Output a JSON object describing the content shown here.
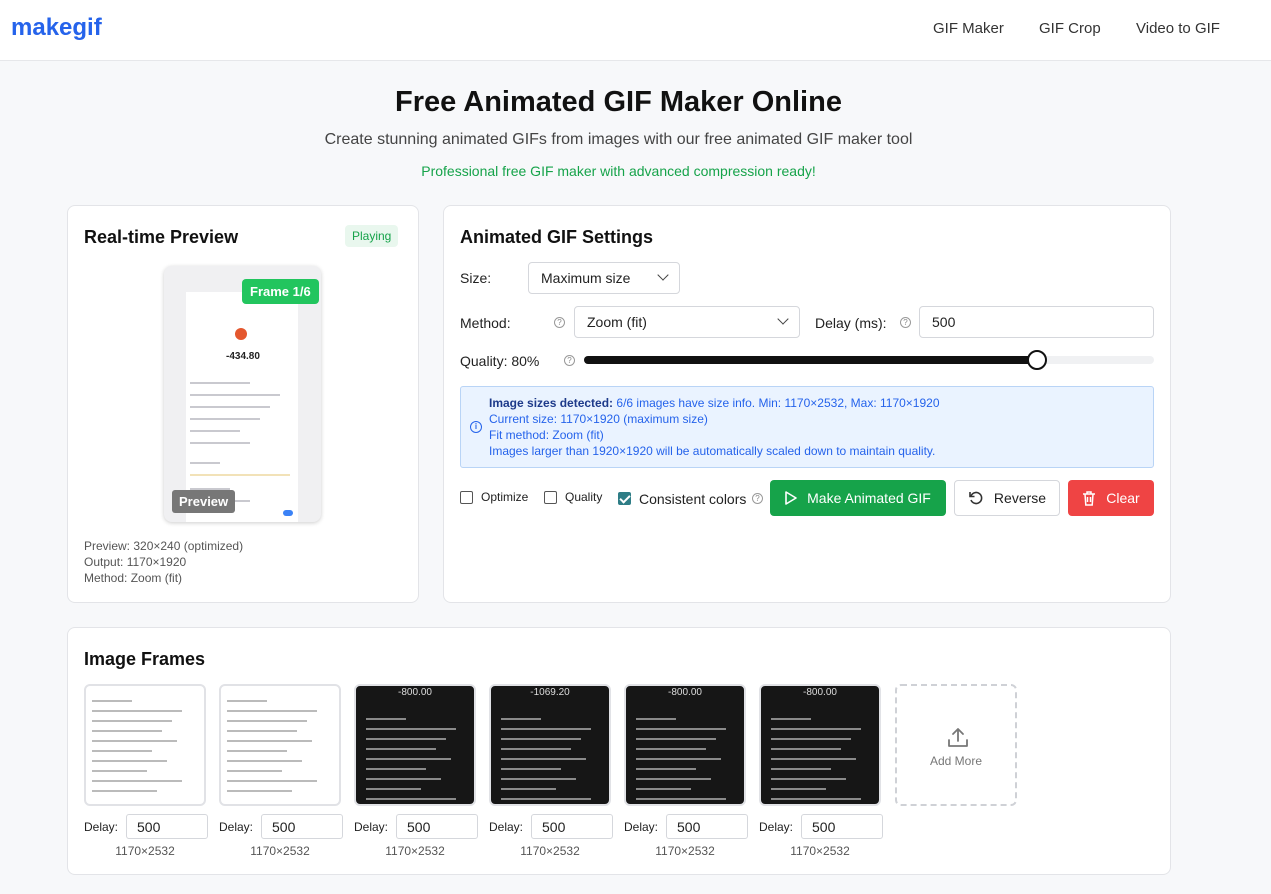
{
  "header": {
    "logo": "makegif",
    "nav": [
      "GIF Maker",
      "GIF Crop",
      "Video to GIF"
    ]
  },
  "hero": {
    "title": "Free Animated GIF Maker Online",
    "subtitle": "Create stunning animated GIFs from images with our free animated GIF maker tool",
    "tagline": "Professional free GIF maker with advanced compression ready!"
  },
  "preview": {
    "title": "Real-time Preview",
    "status": "Playing",
    "frame_badge": "Frame 1/6",
    "preview_tag": "Preview",
    "amount": "-434.80",
    "info": [
      "Preview: 320×240 (optimized)",
      "Output: 1170×1920",
      "Method: Zoom (fit)"
    ]
  },
  "settings": {
    "title": "Animated GIF Settings",
    "size_label": "Size:",
    "size_value": "Maximum size",
    "method_label": "Method:",
    "method_value": "Zoom (fit)",
    "delay_label": "Delay (ms):",
    "delay_value": "500",
    "quality_label": "Quality: 80%",
    "quality_fraction": 0.8,
    "info": {
      "line1_bold": "Image sizes detected:",
      "line1_rest": " 6/6 images have size info. Min: 1170×2532, Max: 1170×1920",
      "line2": "Current size: 1170×1920 (maximum size)",
      "line3": "Fit method: Zoom (fit)",
      "line4": "Images larger than 1920×1920 will be automatically scaled down to maintain quality."
    },
    "checkboxes": [
      {
        "label": "Optimize",
        "checked": false
      },
      {
        "label": "Quality",
        "checked": false
      },
      {
        "label": "Consistent colors",
        "checked": true
      }
    ],
    "make_label": "Make Animated GIF",
    "reverse_label": "Reverse",
    "clear_label": "Clear",
    "colors": {
      "green": "#16a34a",
      "red": "#ef4444",
      "blue": "#2563eb"
    }
  },
  "frames": {
    "title": "Image Frames",
    "delay_label": "Delay:",
    "add_more": "Add More",
    "items": [
      {
        "theme": "light",
        "amount": "",
        "delay": "500",
        "dims": "1170×2532"
      },
      {
        "theme": "light",
        "amount": "",
        "delay": "500",
        "dims": "1170×2532"
      },
      {
        "theme": "dark",
        "amount": "-800.00",
        "delay": "500",
        "dims": "1170×2532"
      },
      {
        "theme": "dark",
        "amount": "-1069.20",
        "delay": "500",
        "dims": "1170×2532"
      },
      {
        "theme": "dark",
        "amount": "-800.00",
        "delay": "500",
        "dims": "1170×2532"
      },
      {
        "theme": "dark",
        "amount": "-800.00",
        "delay": "500",
        "dims": "1170×2532"
      }
    ]
  }
}
